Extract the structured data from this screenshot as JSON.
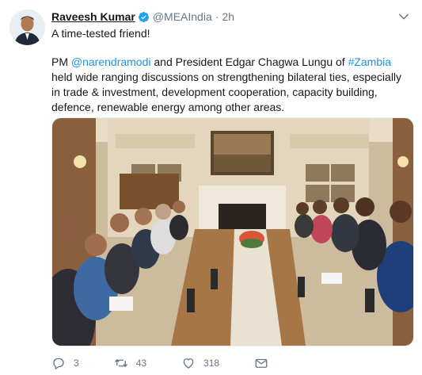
{
  "tweet": {
    "author_name": "Raveesh Kumar",
    "handle": "@MEAIndia",
    "separator": "·",
    "time": "2h",
    "line1": "A time-tested friend!",
    "para": {
      "t1": "PM ",
      "mention": "@narendramodi",
      "t2": " and President Edgar Chagwa Lungu of ",
      "hashtag": "#Zambia",
      "t3": " held wide ranging discussions on strengthening bilateral ties, especially in trade & investment, development cooperation, capacity building, defence, renewable energy among other areas."
    },
    "actions": {
      "reply_count": "3",
      "retweet_count": "43",
      "like_count": "318"
    }
  },
  "icons": {
    "verified": "verified-badge-icon",
    "caret": "chevron-down-icon",
    "reply": "reply-icon",
    "retweet": "retweet-icon",
    "like": "heart-icon",
    "dm": "mail-icon"
  },
  "colors": {
    "link": "#1b95e0",
    "muted": "#657786",
    "text": "#14171a",
    "verified": "#1da1f2"
  }
}
